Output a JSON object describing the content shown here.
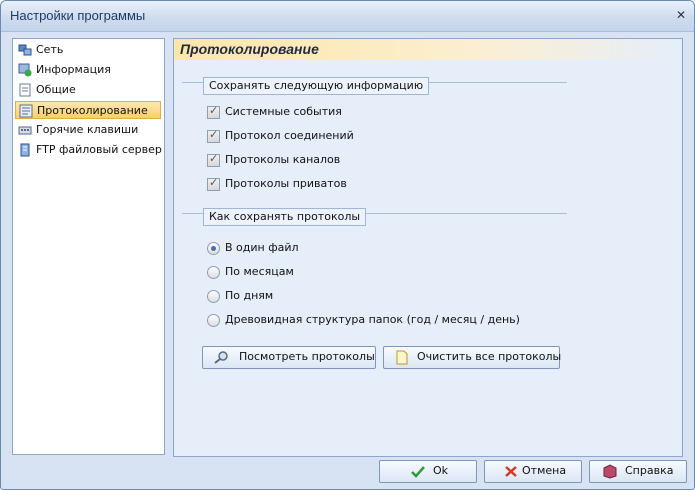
{
  "window": {
    "title": "Настройки программы"
  },
  "tree": {
    "items": [
      {
        "label": "Сеть",
        "icon": "network-icon",
        "selected": false
      },
      {
        "label": "Информация",
        "icon": "info-icon",
        "selected": false
      },
      {
        "label": "Общие",
        "icon": "document-icon",
        "selected": false
      },
      {
        "label": "Протоколирование",
        "icon": "log-icon",
        "selected": true
      },
      {
        "label": "Горячие клавиши",
        "icon": "keyboard-icon",
        "selected": false
      },
      {
        "label": "FTP файловый сервер",
        "icon": "ftp-server-icon",
        "selected": false
      }
    ]
  },
  "panel": {
    "header": "Протоколирование",
    "save_group": {
      "title": "Сохранять следующую информацию",
      "items": [
        {
          "label": "Системные события",
          "checked": true
        },
        {
          "label": "Протокол соединений",
          "checked": true
        },
        {
          "label": "Протоколы каналов",
          "checked": true
        },
        {
          "label": "Протоколы приватов",
          "checked": true
        }
      ]
    },
    "mode_group": {
      "title": "Как сохранять протоколы",
      "options": [
        {
          "label": "В один файл",
          "selected": true
        },
        {
          "label": "По месяцам",
          "selected": false
        },
        {
          "label": "По дням",
          "selected": false
        },
        {
          "label": "Древовидная структура папок (год / месяц / день)",
          "selected": false
        }
      ]
    },
    "buttons": {
      "view": "Посмотреть протоколы",
      "clear": "Очистить все протоколы"
    }
  },
  "footer": {
    "ok": "Ok",
    "cancel": "Отмена",
    "help": "Справка"
  },
  "colors": {
    "selection": "#f8cf6e",
    "window_bg": "#d7e3f3",
    "panel_bg": "#e6eefa",
    "border": "#8ea6c9"
  }
}
